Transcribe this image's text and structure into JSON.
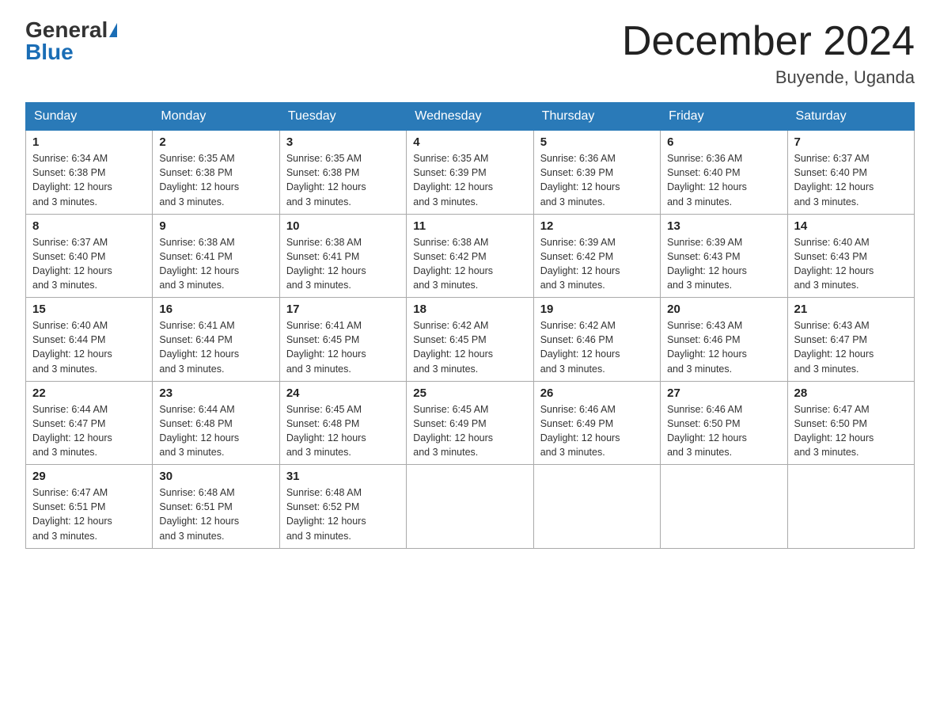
{
  "logo": {
    "general": "General",
    "blue": "Blue"
  },
  "title": "December 2024",
  "location": "Buyende, Uganda",
  "days_of_week": [
    "Sunday",
    "Monday",
    "Tuesday",
    "Wednesday",
    "Thursday",
    "Friday",
    "Saturday"
  ],
  "weeks": [
    [
      {
        "day": "1",
        "sunrise": "6:34 AM",
        "sunset": "6:38 PM",
        "daylight": "12 hours and 3 minutes."
      },
      {
        "day": "2",
        "sunrise": "6:35 AM",
        "sunset": "6:38 PM",
        "daylight": "12 hours and 3 minutes."
      },
      {
        "day": "3",
        "sunrise": "6:35 AM",
        "sunset": "6:38 PM",
        "daylight": "12 hours and 3 minutes."
      },
      {
        "day": "4",
        "sunrise": "6:35 AM",
        "sunset": "6:39 PM",
        "daylight": "12 hours and 3 minutes."
      },
      {
        "day": "5",
        "sunrise": "6:36 AM",
        "sunset": "6:39 PM",
        "daylight": "12 hours and 3 minutes."
      },
      {
        "day": "6",
        "sunrise": "6:36 AM",
        "sunset": "6:40 PM",
        "daylight": "12 hours and 3 minutes."
      },
      {
        "day": "7",
        "sunrise": "6:37 AM",
        "sunset": "6:40 PM",
        "daylight": "12 hours and 3 minutes."
      }
    ],
    [
      {
        "day": "8",
        "sunrise": "6:37 AM",
        "sunset": "6:40 PM",
        "daylight": "12 hours and 3 minutes."
      },
      {
        "day": "9",
        "sunrise": "6:38 AM",
        "sunset": "6:41 PM",
        "daylight": "12 hours and 3 minutes."
      },
      {
        "day": "10",
        "sunrise": "6:38 AM",
        "sunset": "6:41 PM",
        "daylight": "12 hours and 3 minutes."
      },
      {
        "day": "11",
        "sunrise": "6:38 AM",
        "sunset": "6:42 PM",
        "daylight": "12 hours and 3 minutes."
      },
      {
        "day": "12",
        "sunrise": "6:39 AM",
        "sunset": "6:42 PM",
        "daylight": "12 hours and 3 minutes."
      },
      {
        "day": "13",
        "sunrise": "6:39 AM",
        "sunset": "6:43 PM",
        "daylight": "12 hours and 3 minutes."
      },
      {
        "day": "14",
        "sunrise": "6:40 AM",
        "sunset": "6:43 PM",
        "daylight": "12 hours and 3 minutes."
      }
    ],
    [
      {
        "day": "15",
        "sunrise": "6:40 AM",
        "sunset": "6:44 PM",
        "daylight": "12 hours and 3 minutes."
      },
      {
        "day": "16",
        "sunrise": "6:41 AM",
        "sunset": "6:44 PM",
        "daylight": "12 hours and 3 minutes."
      },
      {
        "day": "17",
        "sunrise": "6:41 AM",
        "sunset": "6:45 PM",
        "daylight": "12 hours and 3 minutes."
      },
      {
        "day": "18",
        "sunrise": "6:42 AM",
        "sunset": "6:45 PM",
        "daylight": "12 hours and 3 minutes."
      },
      {
        "day": "19",
        "sunrise": "6:42 AM",
        "sunset": "6:46 PM",
        "daylight": "12 hours and 3 minutes."
      },
      {
        "day": "20",
        "sunrise": "6:43 AM",
        "sunset": "6:46 PM",
        "daylight": "12 hours and 3 minutes."
      },
      {
        "day": "21",
        "sunrise": "6:43 AM",
        "sunset": "6:47 PM",
        "daylight": "12 hours and 3 minutes."
      }
    ],
    [
      {
        "day": "22",
        "sunrise": "6:44 AM",
        "sunset": "6:47 PM",
        "daylight": "12 hours and 3 minutes."
      },
      {
        "day": "23",
        "sunrise": "6:44 AM",
        "sunset": "6:48 PM",
        "daylight": "12 hours and 3 minutes."
      },
      {
        "day": "24",
        "sunrise": "6:45 AM",
        "sunset": "6:48 PM",
        "daylight": "12 hours and 3 minutes."
      },
      {
        "day": "25",
        "sunrise": "6:45 AM",
        "sunset": "6:49 PM",
        "daylight": "12 hours and 3 minutes."
      },
      {
        "day": "26",
        "sunrise": "6:46 AM",
        "sunset": "6:49 PM",
        "daylight": "12 hours and 3 minutes."
      },
      {
        "day": "27",
        "sunrise": "6:46 AM",
        "sunset": "6:50 PM",
        "daylight": "12 hours and 3 minutes."
      },
      {
        "day": "28",
        "sunrise": "6:47 AM",
        "sunset": "6:50 PM",
        "daylight": "12 hours and 3 minutes."
      }
    ],
    [
      {
        "day": "29",
        "sunrise": "6:47 AM",
        "sunset": "6:51 PM",
        "daylight": "12 hours and 3 minutes."
      },
      {
        "day": "30",
        "sunrise": "6:48 AM",
        "sunset": "6:51 PM",
        "daylight": "12 hours and 3 minutes."
      },
      {
        "day": "31",
        "sunrise": "6:48 AM",
        "sunset": "6:52 PM",
        "daylight": "12 hours and 3 minutes."
      },
      null,
      null,
      null,
      null
    ]
  ]
}
